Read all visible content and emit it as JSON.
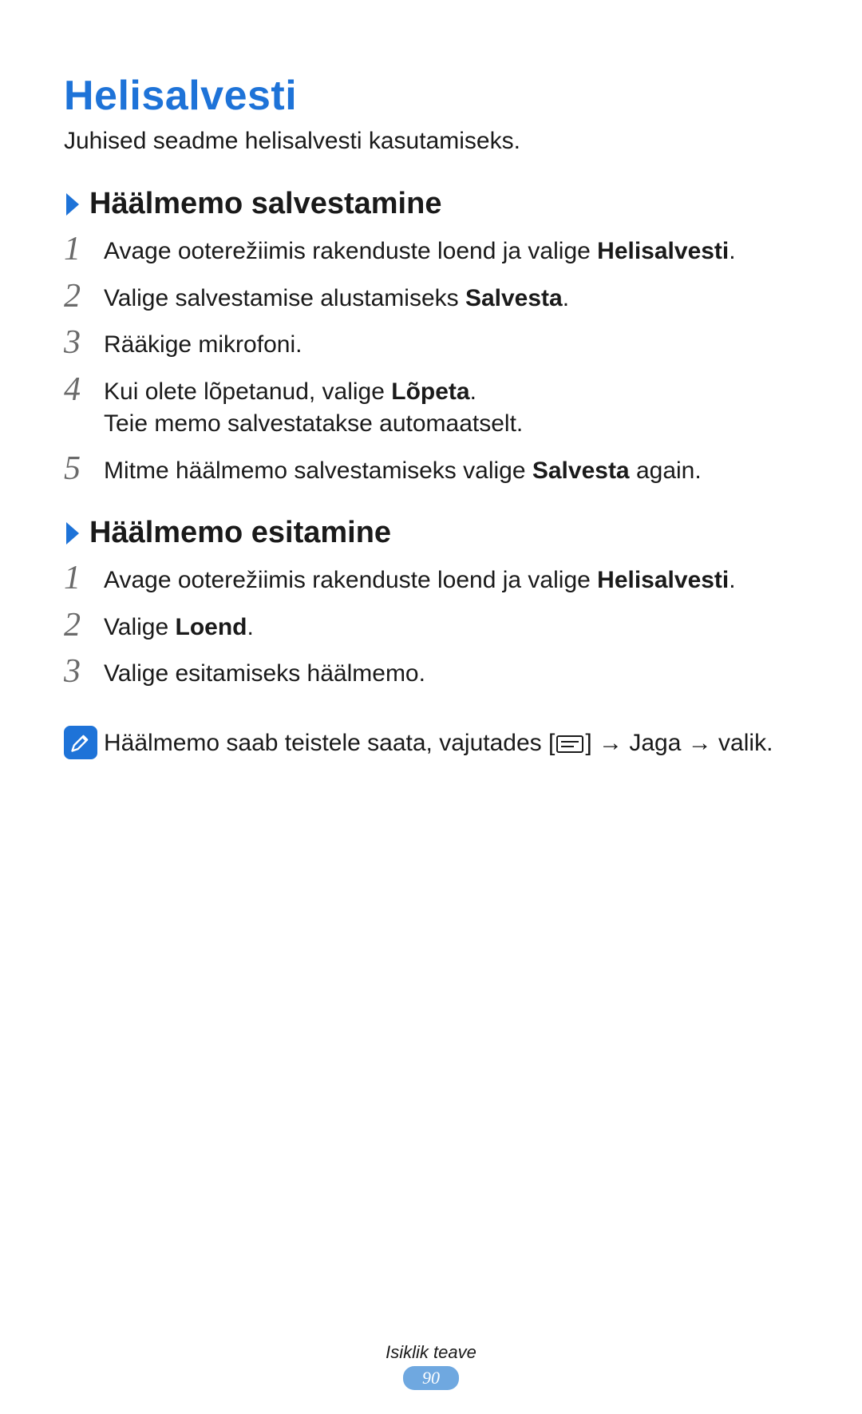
{
  "title": "Helisalvesti",
  "intro": "Juhised seadme helisalvesti kasutamiseks.",
  "section1": {
    "heading": "Häälmemo salvestamine",
    "steps": {
      "s1_pre": "Avage ooterežiimis rakenduste loend ja valige ",
      "s1_bold": "Helisalvesti",
      "s1_post": ".",
      "s2_pre": "Valige salvestamise alustamiseks ",
      "s2_bold": "Salvesta",
      "s2_post": ".",
      "s3": "Rääkige mikrofoni.",
      "s4_pre": "Kui olete lõpetanud, valige ",
      "s4_bold": "Lõpeta",
      "s4_post": ".",
      "s4_line2": "Teie memo salvestatakse automaatselt.",
      "s5_pre": "Mitme häälmemo salvestamiseks valige ",
      "s5_bold": "Salvesta",
      "s5_post": " again."
    },
    "nums": {
      "n1": "1",
      "n2": "2",
      "n3": "3",
      "n4": "4",
      "n5": "5"
    }
  },
  "section2": {
    "heading": "Häälmemo esitamine",
    "steps": {
      "s1_pre": "Avage ooterežiimis rakenduste loend ja valige ",
      "s1_bold": "Helisalvesti",
      "s1_post": ".",
      "s2_pre": "Valige ",
      "s2_bold": "Loend",
      "s2_post": ".",
      "s3": "Valige esitamiseks häälmemo."
    },
    "nums": {
      "n1": "1",
      "n2": "2",
      "n3": "3"
    },
    "note": {
      "pre": "Häälmemo saab teistele saata, vajutades [",
      "mid1": "] → ",
      "bold": "Jaga",
      "mid2": " → valik."
    }
  },
  "footer": {
    "label": "Isiklik teave",
    "page": "90"
  }
}
